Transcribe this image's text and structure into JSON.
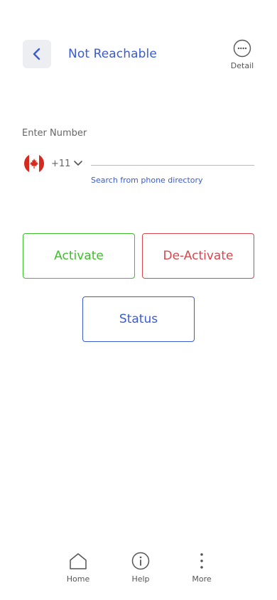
{
  "header": {
    "title": "Not Reachable",
    "detail_label": "Detail",
    "back_icon": "chevron-left-icon",
    "detail_icon": "more-horizontal-circle-icon"
  },
  "number_entry": {
    "label": "Enter Number",
    "country_flag": "canada-flag-icon",
    "country_code": "+11",
    "phone_value": "",
    "search_link": "Search from phone directory"
  },
  "actions": {
    "activate_label": "Activate",
    "deactivate_label": "De-Activate",
    "status_label": "Status"
  },
  "bottom_nav": {
    "items": [
      {
        "label": "Home",
        "icon": "home-icon"
      },
      {
        "label": "Help",
        "icon": "info-icon"
      },
      {
        "label": "More",
        "icon": "more-vertical-icon"
      }
    ]
  },
  "colors": {
    "primary": "#3a5bd0",
    "activate": "#3cbf2a",
    "deactivate": "#d9454d",
    "back_button_bg": "#eceef2"
  }
}
